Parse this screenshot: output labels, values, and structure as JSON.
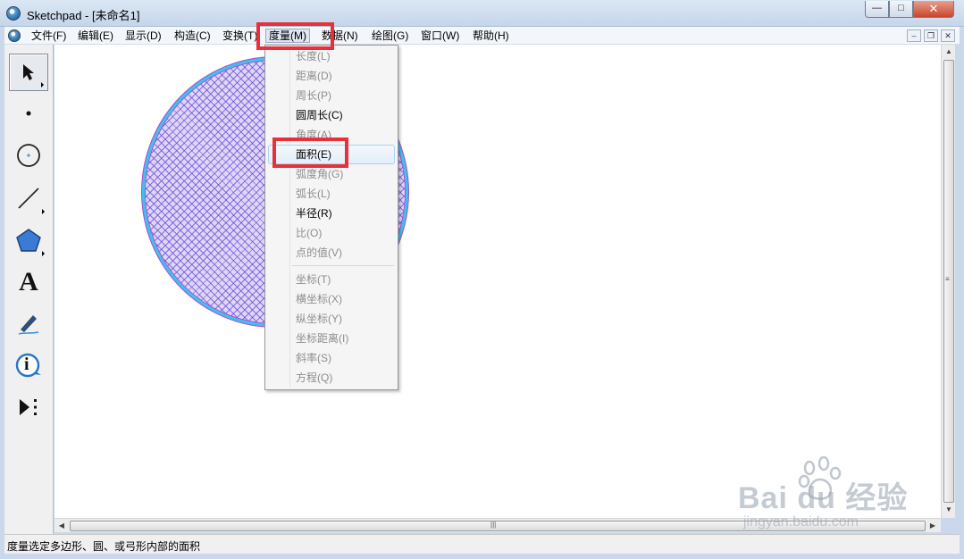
{
  "window": {
    "title": "Sketchpad  - [未命名1]",
    "controls": {
      "minimize": "—",
      "maximize": "□",
      "close": "✕"
    }
  },
  "menubar": {
    "items": [
      {
        "label": "文件(F)"
      },
      {
        "label": "编辑(E)"
      },
      {
        "label": "显示(D)"
      },
      {
        "label": "构造(C)"
      },
      {
        "label": "变换(T)"
      },
      {
        "label": "度量(M)"
      },
      {
        "label": "数据(N)"
      },
      {
        "label": "绘图(G)"
      },
      {
        "label": "窗口(W)"
      },
      {
        "label": "帮助(H)"
      }
    ],
    "active": "度量(M)",
    "mdi_controls": {
      "minimize": "–",
      "restore": "❐",
      "close": "✕"
    }
  },
  "toolbox": {
    "tools": [
      {
        "name": "arrow-select-tool",
        "icon": "arrow-icon",
        "selected": true
      },
      {
        "name": "point-tool",
        "icon": "point-icon"
      },
      {
        "name": "compass-tool",
        "icon": "circle-icon"
      },
      {
        "name": "straightedge-tool",
        "icon": "line-icon"
      },
      {
        "name": "polygon-tool",
        "icon": "pentagon-icon"
      },
      {
        "name": "text-tool",
        "icon": "text-a-icon",
        "glyph": "A"
      },
      {
        "name": "marker-tool",
        "icon": "pen-icon"
      },
      {
        "name": "information-tool",
        "icon": "info-icon",
        "glyph": "i"
      },
      {
        "name": "custom-tool",
        "icon": "custom-tool-icon"
      }
    ]
  },
  "measure_menu": {
    "items": [
      {
        "label": "长度(L)",
        "enabled": false
      },
      {
        "label": "距离(D)",
        "enabled": false
      },
      {
        "label": "周长(P)",
        "enabled": false
      },
      {
        "label": "圆周长(C)",
        "enabled": true
      },
      {
        "label": "角度(A)",
        "enabled": false
      },
      {
        "label": "面积(E)",
        "enabled": true,
        "highlighted": true
      },
      {
        "label": "弧度角(G)",
        "enabled": false
      },
      {
        "label": "弧长(L)",
        "enabled": false
      },
      {
        "label": "半径(R)",
        "enabled": true
      },
      {
        "label": "比(O)",
        "enabled": false
      },
      {
        "label": "点的值(V)",
        "enabled": false
      },
      {
        "label": "坐标(T)",
        "enabled": false
      },
      {
        "label": "横坐标(X)",
        "enabled": false
      },
      {
        "label": "纵坐标(Y)",
        "enabled": false
      },
      {
        "label": "坐标距离(I)",
        "enabled": false
      },
      {
        "label": "斜率(S)",
        "enabled": false
      },
      {
        "label": "方程(Q)",
        "enabled": false
      }
    ]
  },
  "status_bar": {
    "text": "度量选定多边形、圆、或弓形内部的面积"
  },
  "colors": {
    "highlight_box": "#e8303a",
    "circle_border": "#3cc2ee",
    "circle_fill_hatch": "#6e46dc",
    "circle_outline": "#b04ad0"
  },
  "watermark": {
    "logo": "Bai du 经验",
    "url": "jingyan.baidu.com"
  }
}
